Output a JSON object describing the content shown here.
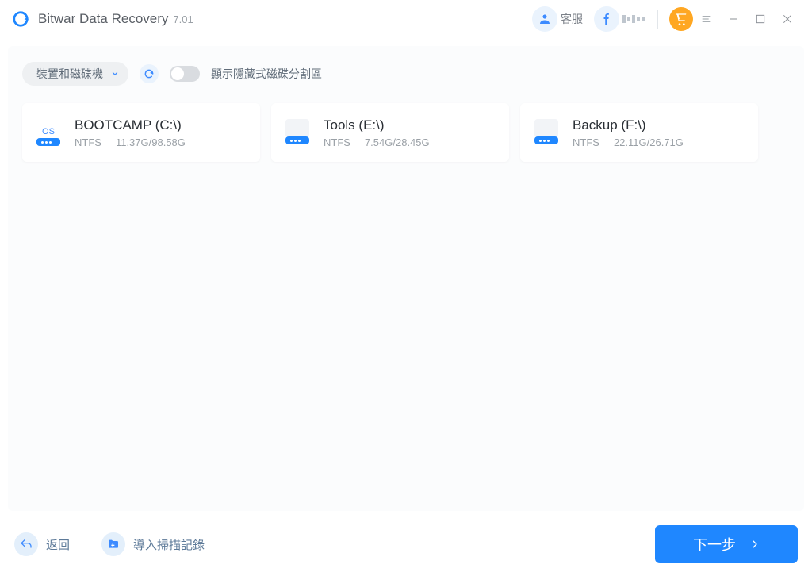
{
  "header": {
    "title": "Bitwar Data Recovery",
    "version": "7.01",
    "support_label": "客服"
  },
  "toolbar": {
    "dropdown_label": "裝置和磁碟機",
    "toggle_label": "顯示隱藏式磁碟分割區"
  },
  "drives": [
    {
      "name": "BOOTCAMP (C:\\)",
      "fs": "NTFS",
      "size": "11.37G/98.58G",
      "os": true
    },
    {
      "name": "Tools (E:\\)",
      "fs": "NTFS",
      "size": "7.54G/28.45G",
      "os": false
    },
    {
      "name": "Backup (F:\\)",
      "fs": "NTFS",
      "size": "22.11G/26.71G",
      "os": false
    }
  ],
  "footer": {
    "back_label": "返回",
    "import_label": "導入掃描記錄",
    "next_label": "下一步"
  }
}
